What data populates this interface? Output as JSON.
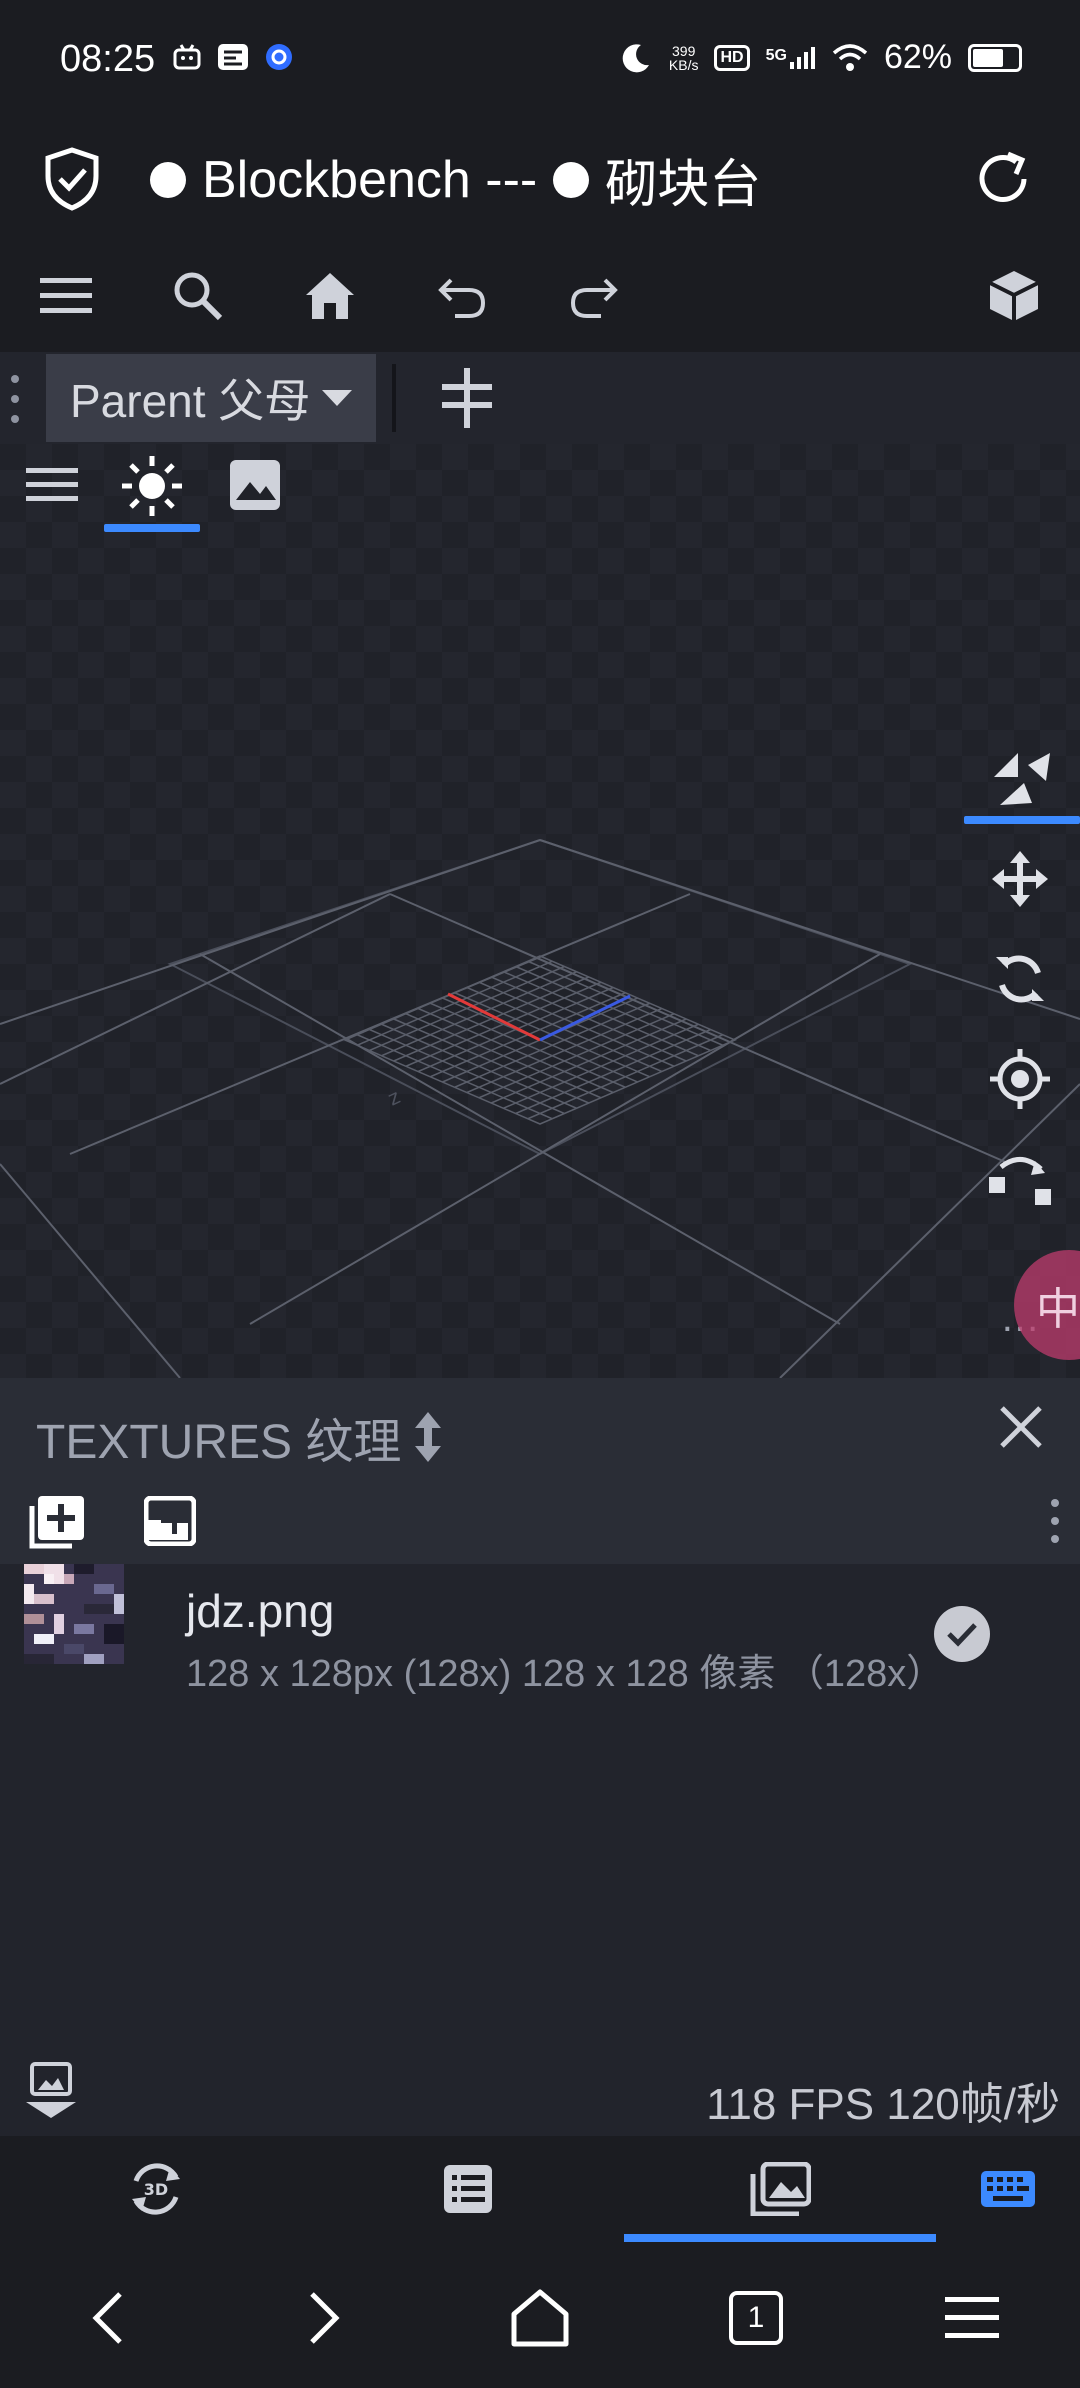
{
  "status_bar": {
    "time": "08:25",
    "net_speed_value": "399",
    "net_speed_unit": "KB/s",
    "hd": "HD",
    "network": "5G",
    "battery": "62%",
    "battery_level": 0.62
  },
  "title_bar": {
    "title_en": "Blockbench ---",
    "title_zh": "砌块台"
  },
  "subbar": {
    "parent_label": "Parent 父母"
  },
  "textures_panel": {
    "title": "TEXTURES 纹理",
    "items": [
      {
        "name": "jdz.png",
        "meta": "128 x 128px (128x) 128 x 128 像素 （128x）",
        "selected": true
      }
    ]
  },
  "ime_bubble": "中",
  "footer": {
    "fps": "118 FPS  120帧/秒"
  },
  "nav": {
    "tab_count": "1"
  },
  "colors": {
    "accent": "#3c8aff",
    "axis_x": "#e23a3a",
    "axis_z": "#3a5ae2"
  }
}
